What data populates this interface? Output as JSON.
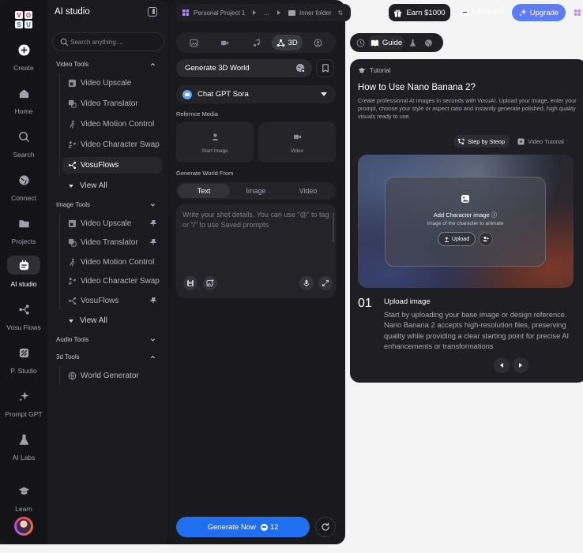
{
  "header": {
    "breadcrumb": {
      "project": "Personal Project 1",
      "ellipsis": "...",
      "folder": "Inner folder"
    },
    "earn_label": "Earn $1000",
    "credits": "9,999,999",
    "upgrade_label": "Upgrade"
  },
  "rail": {
    "items": [
      {
        "label": "Create"
      },
      {
        "label": "Home"
      },
      {
        "label": "Search"
      },
      {
        "label": "Connect"
      },
      {
        "label": "Projects"
      },
      {
        "label": "AI studio"
      },
      {
        "label": "Vosu Flows"
      },
      {
        "label": "P. Studio"
      },
      {
        "label": "Prompt GPT"
      },
      {
        "label": "AI Labs"
      },
      {
        "label": "Learn"
      }
    ]
  },
  "menu": {
    "title": "AI studio",
    "search_placeholder": "Search anything....",
    "video_tools": {
      "heading": "Video Tools",
      "items": [
        "Video Upscale",
        "Video Translator",
        "Video Motion Control",
        "Video Character Swap",
        "VosuFlows"
      ],
      "view_all": "View All"
    },
    "image_tools": {
      "heading": "Image Tools",
      "items": [
        "Video Upscale",
        "Video Translator",
        "Video Motion Control",
        "Video Character Swap",
        "VosuFlows"
      ],
      "view_all": "View All"
    },
    "audio_tools": {
      "heading": "Audio Tools"
    },
    "three_d_tools": {
      "heading": "3d Tools",
      "items": [
        "World Generator"
      ]
    }
  },
  "composer": {
    "active_tab_label": "3D",
    "generate_world_label": "Generate 3D World",
    "model_label": "Chat GPT Sora",
    "reference_media_label": "Refernce Media",
    "start_image_label": "Start Image",
    "video_label": "Video",
    "generate_from_label": "Generate World From",
    "modes": [
      "Text",
      "Image",
      "Video"
    ],
    "prompt_placeholder": "Write your shot details. You can use “@” to tag or “/” to use Saved prompts",
    "generate_now_label": "Generate Now",
    "generate_cost": "12"
  },
  "guide": {
    "active_tab_label": "Guide",
    "section_label": "Tutorial",
    "title": "How to Use Nano Banana 2?",
    "description": "Create professional AI images in seconds with VosuAI. Upload your image, enter your prompt, choose your style or aspect ratio and instantly generate polished, high quality visuals ready to use.",
    "step_by_step_label": "Step by Steop",
    "video_tutorial_label": "Video Tutorial",
    "preview": {
      "title": "Add Character image",
      "subtitle": "Image of the character to animate",
      "upload_label": "Upload"
    },
    "step": {
      "number": "01",
      "title": "Upload image",
      "description": "Start by uploading your base image or design reference. Nano Banana 2 accepts high-resolution files, preserving quality while providing a clear starting point for precise AI enhancements or transformations"
    }
  },
  "colors": {
    "accent_blue": "#1f6ff0",
    "upgrade_purple": "#5d7cf6",
    "panel": "#1b1b1f"
  }
}
